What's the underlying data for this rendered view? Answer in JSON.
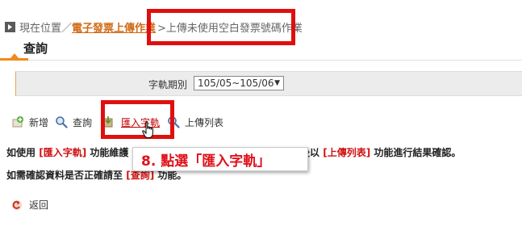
{
  "breadcrumb": {
    "prefix": "現在位置／",
    "link": "電子發票上傳作業",
    "current": ">上傳未使用空白發票號碼作業"
  },
  "page_title": "查詢",
  "query": {
    "label": "字軌期別",
    "period_value": "105/05~105/06"
  },
  "toolbar": {
    "add_label": "新增",
    "search_label": "查詢",
    "import_label": "匯入字軌",
    "upload_list_label": "上傳列表"
  },
  "info": {
    "line1_start": "如使用",
    "line1_tag1": "[匯入字軌]",
    "line1_mid": "功能維護",
    "line1_end_pre": "後以",
    "line1_tag2": "[上傳列表]",
    "line1_end": "功能進行結果確認。",
    "line2_start": "如需確認資料是否正確請至",
    "line2_tag": "[查詢]",
    "line2_end": "功能。"
  },
  "callout": {
    "text": "8. 點選「匯入字軌」"
  },
  "back_label": "返回",
  "colors": {
    "highlight_red": "#e00f0f",
    "accent_orange": "#f08a1a",
    "link_orange": "#d06a15",
    "tag_red": "#d01010"
  }
}
